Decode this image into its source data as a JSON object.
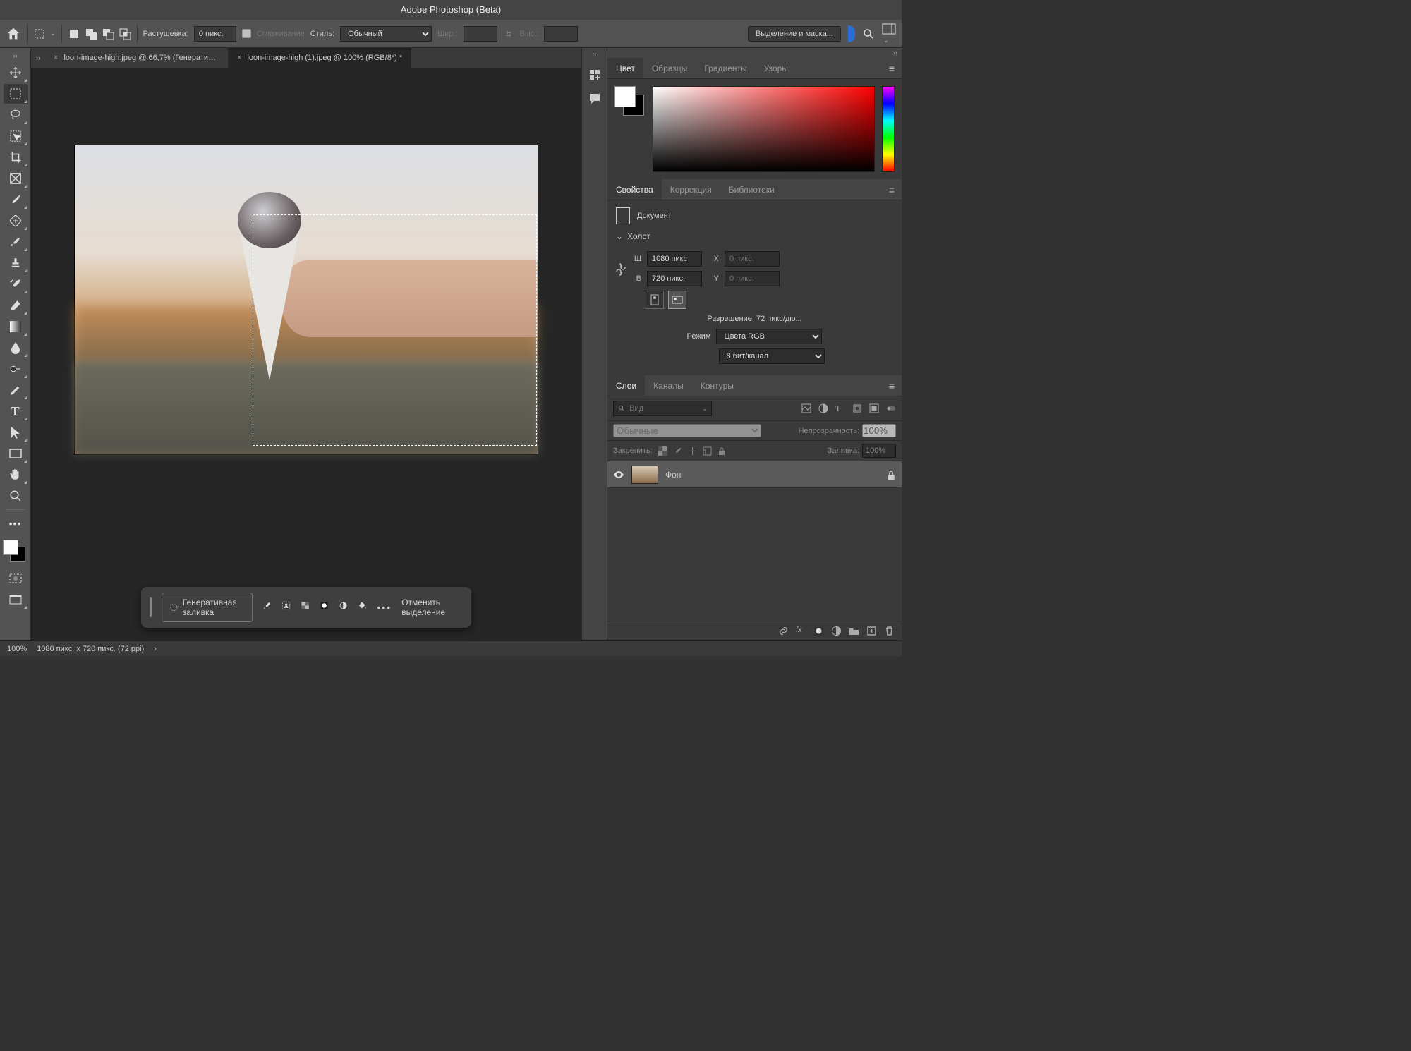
{
  "title": "Adobe Photoshop (Beta)",
  "options_bar": {
    "feather_label": "Растушевка:",
    "feather_value": "0 пикс.",
    "antialias_label": "Сглаживание",
    "style_label": "Стиль:",
    "style_value": "Обычный",
    "width_label": "Шир.:",
    "height_label": "Выс.:",
    "select_mask_btn": "Выделение и маска..."
  },
  "tabs": [
    {
      "label": "loon-image-high.jpeg @ 66,7% (Генеративны...",
      "active": false
    },
    {
      "label": "loon-image-high (1).jpeg @ 100% (RGB/8*) *",
      "active": true
    }
  ],
  "context_bar": {
    "gen_fill": "Генеративная заливка",
    "deselect": "Отменить выделение"
  },
  "color_tabs": [
    "Цвет",
    "Образцы",
    "Градиенты",
    "Узоры"
  ],
  "props_tabs": [
    "Свойства",
    "Коррекция",
    "Библиотеки"
  ],
  "properties": {
    "doc_label": "Документ",
    "canvas_label": "Холст",
    "w_label": "Ш",
    "w_value": "1080 пикс",
    "h_label": "В",
    "h_value": "720 пикс.",
    "x_label": "X",
    "x_value": "0 пикс.",
    "y_label": "Y",
    "y_value": "0 пикс.",
    "resolution": "Разрешение: 72 пикс/дю...",
    "mode_label": "Режим",
    "mode_value": "Цвета RGB",
    "depth_value": "8 бит/канал"
  },
  "layers_tabs": [
    "Слои",
    "Каналы",
    "Контуры"
  ],
  "layers": {
    "search_placeholder": "Вид",
    "blend_mode": "Обычные",
    "opacity_label": "Непрозрачность:",
    "opacity_value": "100%",
    "lock_label": "Закрепить:",
    "fill_label": "Заливка:",
    "fill_value": "100%",
    "layer_name": "Фон"
  },
  "statusbar": {
    "zoom": "100%",
    "docinfo": "1080 пикс. x 720 пикс. (72 ppi)"
  }
}
